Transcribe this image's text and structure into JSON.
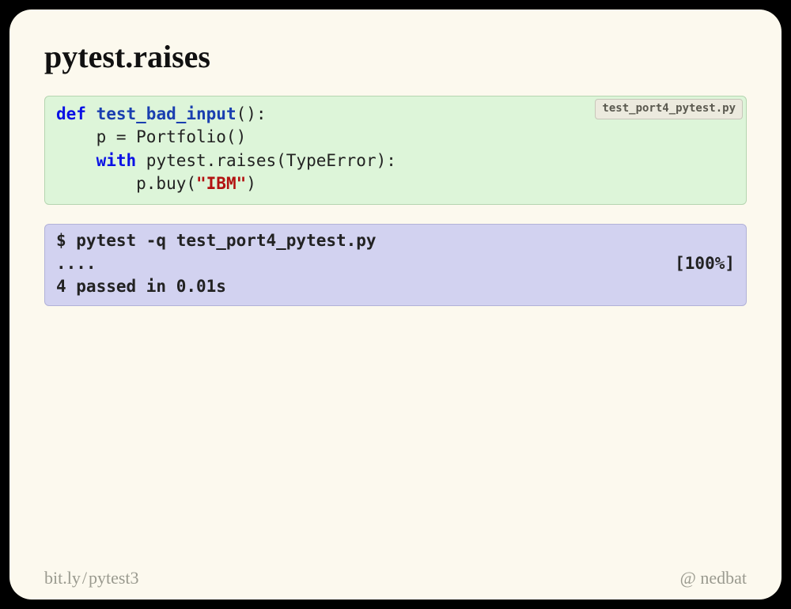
{
  "title": "pytest.raises",
  "code": {
    "file_tag": "test_port4_pytest.py",
    "kw_def": "def",
    "fn_name": "test_bad_input",
    "line1_rest": "():",
    "line2": "    p = Portfolio()",
    "kw_with": "with",
    "line3_rest": " pytest.raises(TypeError):",
    "line4_pre": "        p.buy(",
    "str_ibm": "\"IBM\"",
    "line4_post": ")"
  },
  "shell": {
    "cmd": "$ pytest -q test_port4_pytest.py",
    "dots": "....",
    "pct": "[100%]",
    "result": "4 passed in 0.01s"
  },
  "footer": {
    "left_prefix": "bit.ly",
    "left_sep": "/",
    "left_suffix": "pytest3",
    "right_prefix": "@",
    "right_suffix": "nedbat"
  }
}
